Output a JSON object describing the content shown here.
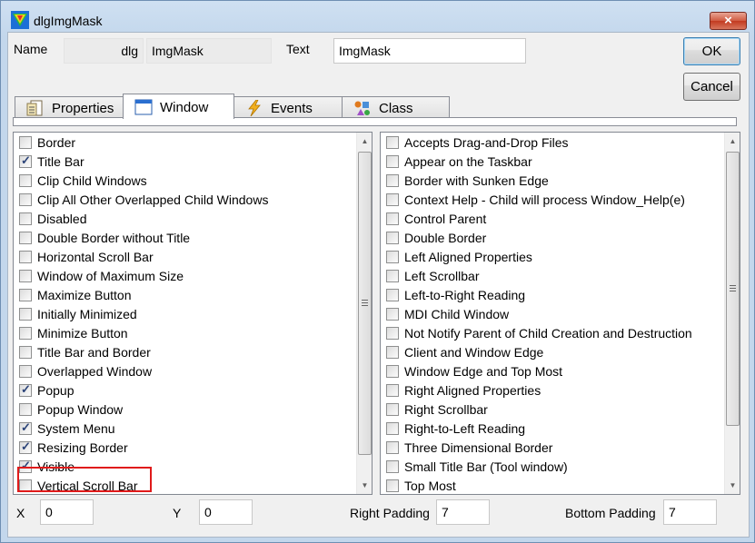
{
  "window": {
    "title": "dlgImgMask",
    "close_symbol": "×"
  },
  "header": {
    "name_label": "Name",
    "name_prefix": "dlg",
    "name_value": "ImgMask",
    "text_label": "Text",
    "text_value": "ImgMask"
  },
  "buttons": {
    "ok": "OK",
    "cancel": "Cancel"
  },
  "tabs": [
    {
      "label": "Properties",
      "icon": "properties-icon"
    },
    {
      "label": "Window",
      "icon": "window-icon",
      "active": true
    },
    {
      "label": "Events",
      "icon": "lightning-icon"
    },
    {
      "label": "Class",
      "icon": "class-icon"
    }
  ],
  "left_list": [
    {
      "label": "Border",
      "checked": false
    },
    {
      "label": "Title Bar",
      "checked": true
    },
    {
      "label": "Clip Child Windows",
      "checked": false
    },
    {
      "label": "Clip All Other Overlapped Child Windows",
      "checked": false
    },
    {
      "label": "Disabled",
      "checked": false
    },
    {
      "label": "Double Border without Title",
      "checked": false
    },
    {
      "label": "Horizontal Scroll Bar",
      "checked": false
    },
    {
      "label": "Window of Maximum Size",
      "checked": false
    },
    {
      "label": "Maximize Button",
      "checked": false
    },
    {
      "label": "Initially Minimized",
      "checked": false
    },
    {
      "label": "Minimize Button",
      "checked": false
    },
    {
      "label": "Title Bar and Border",
      "checked": false
    },
    {
      "label": "Overlapped Window",
      "checked": false
    },
    {
      "label": "Popup",
      "checked": true
    },
    {
      "label": "Popup Window",
      "checked": false
    },
    {
      "label": "System Menu",
      "checked": true
    },
    {
      "label": "Resizing Border",
      "checked": true
    },
    {
      "label": "Visible",
      "checked": true
    },
    {
      "label": "Vertical Scroll Bar",
      "checked": false
    }
  ],
  "right_list": [
    {
      "label": "Accepts Drag-and-Drop Files",
      "checked": false
    },
    {
      "label": "Appear on the Taskbar",
      "checked": false
    },
    {
      "label": "Border with Sunken Edge",
      "checked": false
    },
    {
      "label": "Context Help - Child will process Window_Help(e)",
      "checked": false
    },
    {
      "label": "Control Parent",
      "checked": false
    },
    {
      "label": "Double Border",
      "checked": false
    },
    {
      "label": "Left Aligned Properties",
      "checked": false
    },
    {
      "label": "Left Scrollbar",
      "checked": false
    },
    {
      "label": "Left-to-Right Reading",
      "checked": false
    },
    {
      "label": "MDI Child Window",
      "checked": false
    },
    {
      "label": "Not Notify Parent of Child Creation and Destruction",
      "checked": false
    },
    {
      "label": "Client and Window Edge",
      "checked": false
    },
    {
      "label": "Window Edge and Top Most",
      "checked": false
    },
    {
      "label": "Right Aligned Properties",
      "checked": false
    },
    {
      "label": "Right Scrollbar",
      "checked": false
    },
    {
      "label": "Right-to-Left Reading",
      "checked": false
    },
    {
      "label": "Three Dimensional Border",
      "checked": false
    },
    {
      "label": "Small Title Bar (Tool window)",
      "checked": false
    },
    {
      "label": "Top Most",
      "checked": false
    }
  ],
  "footer": {
    "x_label": "X",
    "x_value": "0",
    "y_label": "Y",
    "y_value": "0",
    "right_padding_label": "Right Padding",
    "right_padding_value": "7",
    "bottom_padding_label": "Bottom Padding",
    "bottom_padding_value": "7"
  },
  "glyphs": {
    "check": "✓",
    "arrow_up": "▲",
    "arrow_down": "▼"
  },
  "colors": {
    "highlight": "#e01a1a",
    "check": "#2b4378"
  }
}
